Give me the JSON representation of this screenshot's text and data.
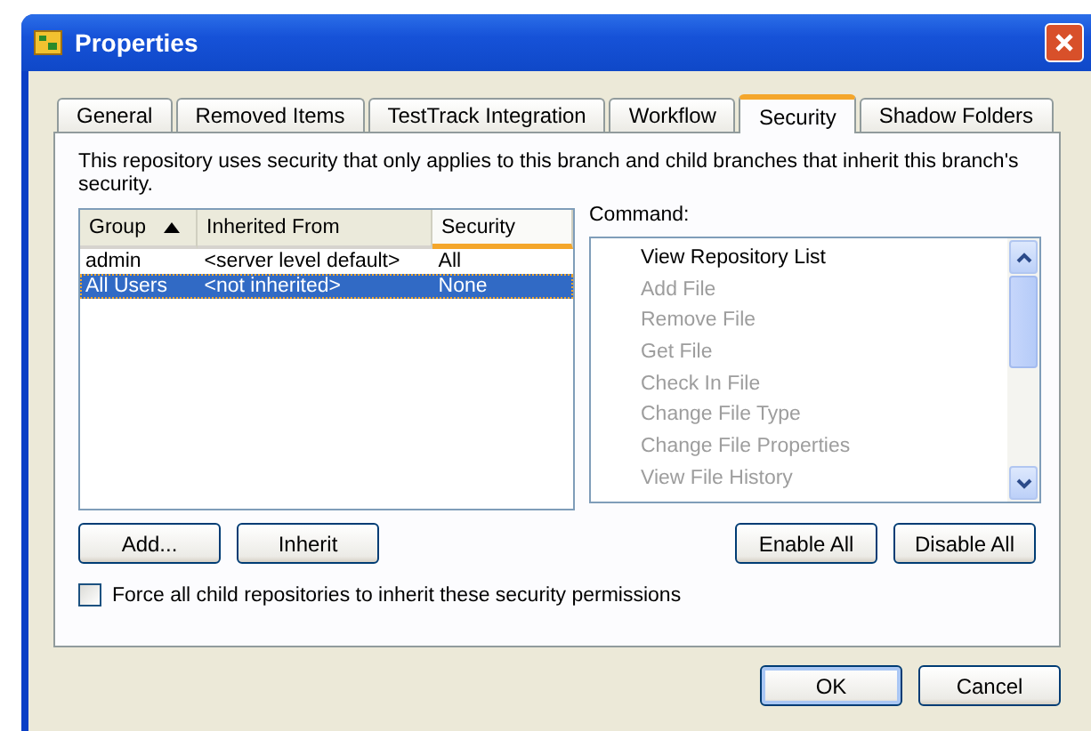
{
  "window": {
    "title": "Properties"
  },
  "tabs": [
    {
      "label": "General",
      "selected": false
    },
    {
      "label": "Removed Items",
      "selected": false
    },
    {
      "label": "TestTrack Integration",
      "selected": false
    },
    {
      "label": "Workflow",
      "selected": false
    },
    {
      "label": "Security",
      "selected": true
    },
    {
      "label": "Shadow Folders",
      "selected": false
    }
  ],
  "description": "This repository uses security that only applies to this branch and child branches that inherit this branch's security.",
  "table": {
    "columns": [
      {
        "label": "Group",
        "sorted": true,
        "hovered": false
      },
      {
        "label": "Inherited From",
        "sorted": false,
        "hovered": false
      },
      {
        "label": "Security",
        "sorted": false,
        "hovered": true
      }
    ],
    "rows": [
      {
        "cells": [
          "admin",
          "<server level default>",
          "All"
        ],
        "selected": false
      },
      {
        "cells": [
          "All Users",
          "<not inherited>",
          "None"
        ],
        "selected": true
      }
    ]
  },
  "command_label": "Command:",
  "commands": [
    {
      "label": "View Repository List",
      "disabled": false
    },
    {
      "label": "Add File",
      "disabled": true
    },
    {
      "label": "Remove File",
      "disabled": true
    },
    {
      "label": "Get File",
      "disabled": true
    },
    {
      "label": "Check In File",
      "disabled": true
    },
    {
      "label": "Change File Type",
      "disabled": true
    },
    {
      "label": "Change File Properties",
      "disabled": true
    },
    {
      "label": "View File History",
      "disabled": true
    }
  ],
  "left_buttons": [
    "Add...",
    "Inherit"
  ],
  "right_buttons": [
    "Enable All",
    "Disable All"
  ],
  "force_checkbox": {
    "label": "Force all child repositories to inherit these security permissions",
    "checked": false
  },
  "dialog_buttons": [
    "OK",
    "Cancel"
  ]
}
